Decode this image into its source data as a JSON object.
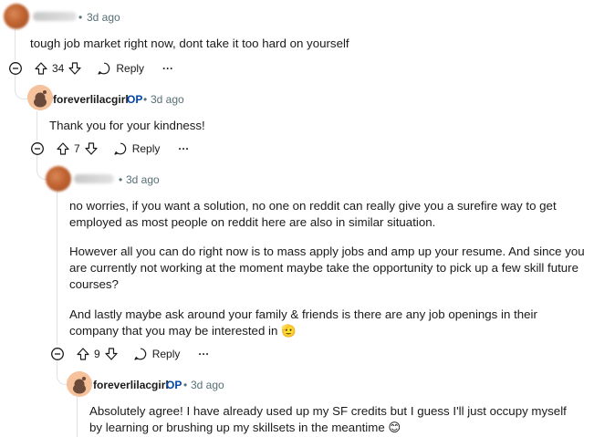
{
  "comments": [
    {
      "author": "",
      "time": "3d ago",
      "body": "tough job market right now, dont take it too hard on yourself",
      "votes": "34",
      "reply_label": "Reply",
      "more_label": "···"
    },
    {
      "author": "foreverlilacgirl",
      "op_badge": "OP",
      "time": "3d ago",
      "body": "Thank you for your kindness!",
      "votes": "7",
      "reply_label": "Reply",
      "more_label": "···"
    },
    {
      "author": "",
      "time": "3d ago",
      "paragraphs": [
        "no worries, if you want a solution, no one on reddit can really give you a surefire way to get employed as most people on reddit here are also in similar situation.",
        "However all you can do right now is to mass apply jobs and amp up your resume. And since you are currently not working at the moment maybe take the opportunity to pick up a few skill future courses?",
        "And lastly maybe ask around your family & friends is there are any job openings in their company that you may be interested in 🫡"
      ],
      "votes": "9",
      "reply_label": "Reply",
      "more_label": "···"
    },
    {
      "author": "foreverlilacgirl",
      "op_badge": "OP",
      "time": "3d ago",
      "body": "Absolutely agree! I have already used up my SF credits but I guess I'll just occupy myself by learning or brushing up my skillsets in the meantime 😊"
    }
  ],
  "colors": {
    "op_badge": "#0045ac",
    "meta_text": "#576f76",
    "thread_line": "#dfe3e5"
  },
  "icons": {
    "collapse": "minus-circle-icon",
    "upvote": "upvote-arrow-icon",
    "downvote": "downvote-arrow-icon",
    "reply": "speech-bubble-icon",
    "more": "ellipsis-icon"
  }
}
